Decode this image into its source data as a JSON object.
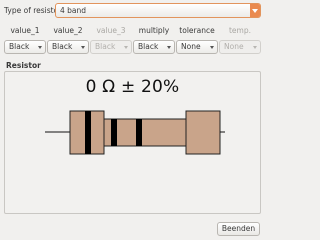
{
  "type_row": {
    "label": "Type of resistor:",
    "value": "4 band"
  },
  "headers": [
    {
      "label": "value_1",
      "enabled": true
    },
    {
      "label": "value_2",
      "enabled": true
    },
    {
      "label": "value_3",
      "enabled": false
    },
    {
      "label": "multiply",
      "enabled": true
    },
    {
      "label": "tolerance",
      "enabled": true
    },
    {
      "label": "temp.",
      "enabled": false
    }
  ],
  "bands": [
    {
      "value": "Black",
      "enabled": true
    },
    {
      "value": "Black",
      "enabled": true
    },
    {
      "value": "Black",
      "enabled": false
    },
    {
      "value": "Black",
      "enabled": true
    },
    {
      "value": "None",
      "enabled": true
    },
    {
      "value": "None",
      "enabled": false
    }
  ],
  "resistor": {
    "title": "Resistor",
    "value_text": "0 Ω ± 20%",
    "body_color": "#c9a48a",
    "band_colors": [
      "#000000",
      "#000000",
      "#000000"
    ]
  },
  "footer": {
    "close_label": "Beenden"
  }
}
